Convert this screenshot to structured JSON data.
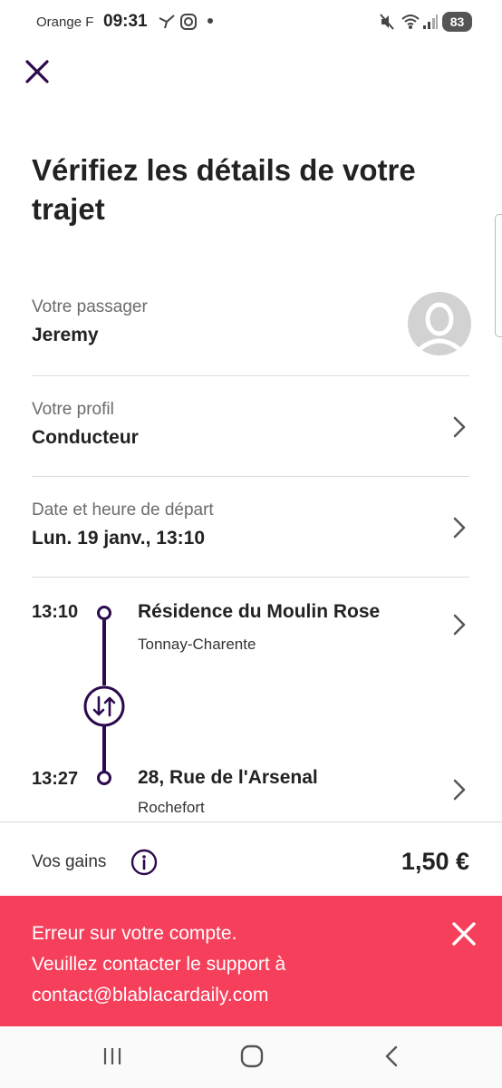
{
  "status_bar": {
    "carrier": "Orange F",
    "time": "09:31",
    "battery": "83"
  },
  "page": {
    "title": "Vérifiez les détails de votre trajet"
  },
  "passenger": {
    "label": "Votre passager",
    "name": "Jeremy"
  },
  "profile": {
    "label": "Votre profil",
    "value": "Conducteur"
  },
  "departure": {
    "label": "Date et heure de départ",
    "value": "Lun. 19 janv., 13:10"
  },
  "route": {
    "origin": {
      "time": "13:10",
      "name": "Résidence du Moulin Rose",
      "city": "Tonnay-Charente"
    },
    "destination": {
      "time": "13:27",
      "name": "28, Rue de l'Arsenal",
      "city": "Rochefort"
    }
  },
  "earnings": {
    "label": "Vos gains",
    "value": "1,50 €"
  },
  "error": {
    "line1": "Erreur sur votre compte.",
    "line2": "Veuillez contacter le support à",
    "line3": "contact@blablacardaily.com"
  },
  "colors": {
    "brand_purple": "#2d0a4e",
    "error_red": "#f53f5b"
  }
}
